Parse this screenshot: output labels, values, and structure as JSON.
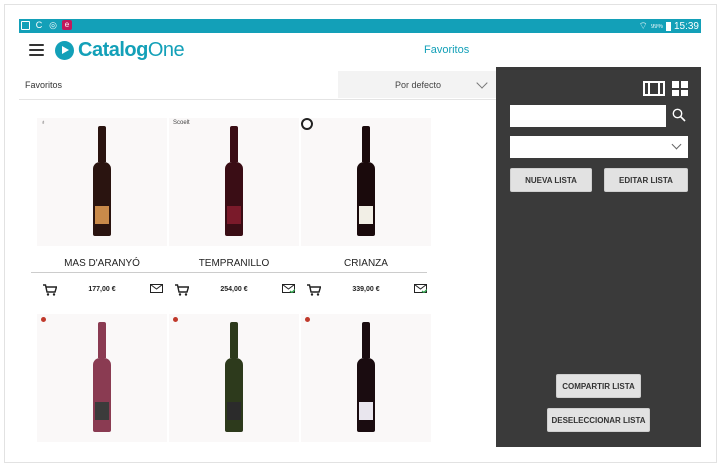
{
  "status_bar": {
    "time": "15:39",
    "battery_text": "99%",
    "left_icons": [
      "gallery-icon",
      "c-icon",
      "target-icon",
      "mail-app-icon"
    ],
    "c_glyph": "C",
    "e_glyph": "e"
  },
  "header": {
    "logo_bold": "Catalog",
    "logo_thin": "One",
    "title": "Favoritos",
    "accent_color": "#13a0b8"
  },
  "toolbar": {
    "label": "Favoritos",
    "sort_selected": "Por defecto"
  },
  "products": [
    {
      "name": "MAS D'ARANYÓ",
      "price": "177,00 €",
      "brand": "♁",
      "bottle_color": "#2a1410",
      "label_color": "#c98a4a"
    },
    {
      "name": "TEMPRANILLO",
      "price": "254,00 €",
      "brand": "Scoelt",
      "bottle_color": "#3a0d15",
      "label_color": "#7a1a2a"
    },
    {
      "name": "CRIANZA",
      "price": "339,00 €",
      "brand": "",
      "bottle_color": "#1a0a0c",
      "label_color": "#f2efe6"
    },
    {
      "name": "",
      "price": "",
      "brand": "",
      "bottle_color": "#8a3b52",
      "label_color": "#3b3b3b"
    },
    {
      "name": "",
      "price": "",
      "brand": "",
      "bottle_color": "#2d3a1c",
      "label_color": "#2b2b2b"
    },
    {
      "name": "",
      "price": "",
      "brand": "",
      "bottle_color": "#1a0c10",
      "label_color": "#e9e6ee"
    }
  ],
  "panel": {
    "search_placeholder": "",
    "list_selected": "",
    "buttons": {
      "nueva_lista": "NUEVA LISTA",
      "editar_lista": "EDITAR LISTA",
      "compartir_lista": "COMPARTIR LISTA",
      "deseleccionar_lista": "DESELECCIONAR LISTA"
    },
    "background_color": "#3a3a3a"
  }
}
